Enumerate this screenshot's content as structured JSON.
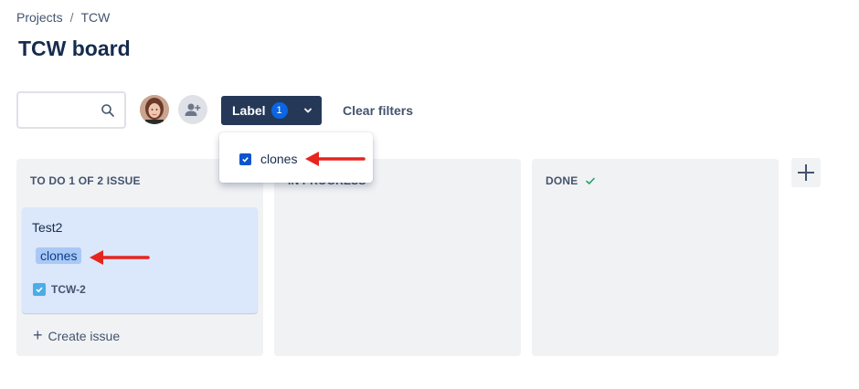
{
  "breadcrumb": {
    "projects": "Projects",
    "separator": "/",
    "project": "TCW"
  },
  "page": {
    "title": "TCW board"
  },
  "toolbar": {
    "search_placeholder": "",
    "label_filter": {
      "label": "Label",
      "count": "1"
    },
    "clear_filters": "Clear filters"
  },
  "label_dropdown": {
    "option": "clones",
    "checked": true
  },
  "columns": [
    {
      "name": "TO DO 1 OF 2 ISSUE"
    },
    {
      "name": "IN PROGRESS"
    },
    {
      "name": "DONE"
    }
  ],
  "card": {
    "title": "Test2",
    "label": "clones",
    "key": "TCW-2"
  },
  "create_issue": "Create issue",
  "colors": {
    "primary_button": "#253858",
    "badge": "#0c66e4",
    "card_bg": "#dbe7fb",
    "arrow": "#e5251e",
    "done_check": "#22a06b"
  }
}
